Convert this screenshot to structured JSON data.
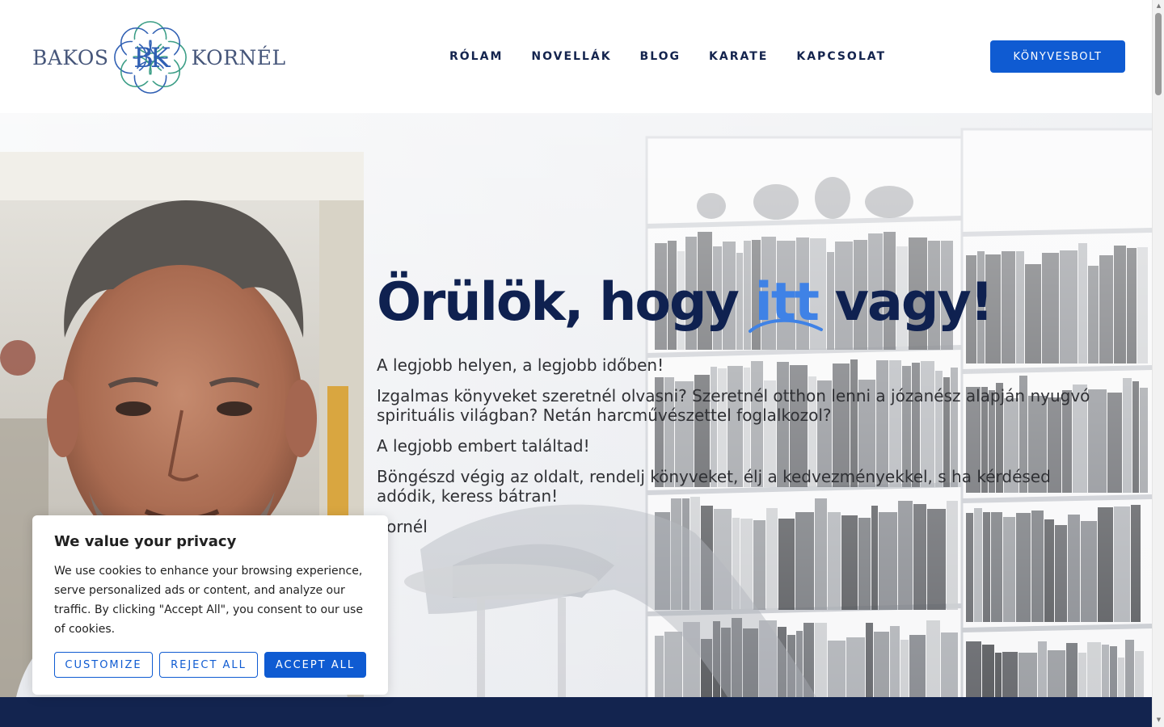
{
  "brand": {
    "name_first": "BAKOS",
    "name_last": "KORNÉL",
    "monogram": "BK",
    "colors": {
      "green": "#3a9d85",
      "blue": "#2f5fb3",
      "text": "#46567a"
    }
  },
  "nav": {
    "items": [
      {
        "label": "RÓLAM"
      },
      {
        "label": "NOVELLÁK"
      },
      {
        "label": "BLOG"
      },
      {
        "label": "KARATE"
      },
      {
        "label": "KAPCSOLAT"
      }
    ],
    "shop_button": "KÖNYVESBOLT"
  },
  "hero": {
    "title_before": "Örülök, hogy",
    "title_accent": "itt",
    "title_after": "vagy!",
    "paragraphs": [
      "A legjobb helyen, a legjobb időben!",
      "Izgalmas könyveket szeretnél olvasni? Szeretnél otthon lenni a józanész alapján nyugvó spirituális világban? Netán harcművészettel foglalkozol?",
      "A legjobb embert találtad!",
      "Böngészd végig az oldalt, rendelj könyveket, élj a kedvezményekkel, s ha kérdésed adódik, keress bátran!",
      "Kornél"
    ]
  },
  "cookie": {
    "title": "We value your privacy",
    "text": "We use cookies to enhance your browsing experience, serve personalized ads or content, and analyze our traffic. By clicking \"Accept All\", you consent to our use of cookies.",
    "customize": "CUSTOMIZE",
    "reject": "REJECT ALL",
    "accept": "ACCEPT ALL"
  },
  "colors": {
    "navy": "#13244f",
    "accent_blue": "#0f5bd2",
    "highlight_blue": "#3f82e6"
  }
}
